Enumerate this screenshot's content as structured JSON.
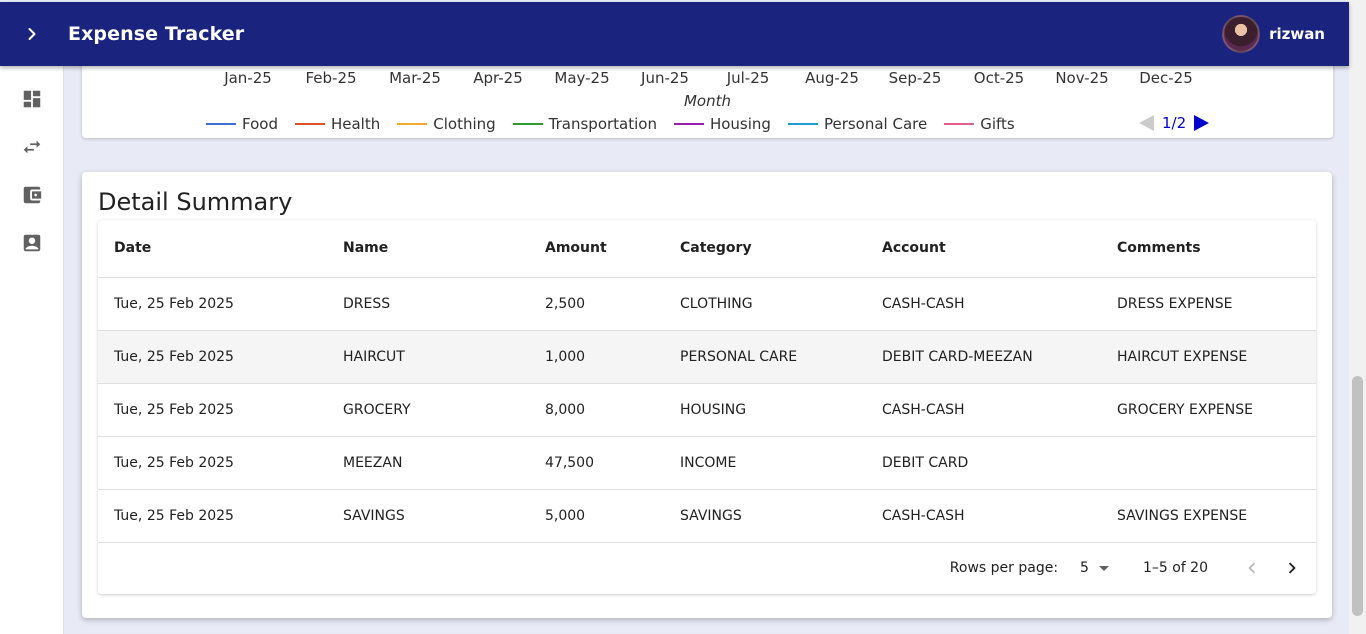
{
  "app": {
    "title": "Expense Tracker",
    "username": "rizwan"
  },
  "sidebar": {
    "items": [
      {
        "name": "dashboard",
        "icon": "dashboard-icon"
      },
      {
        "name": "transactions",
        "icon": "swap-horiz-icon"
      },
      {
        "name": "accounts",
        "icon": "wallet-icon"
      },
      {
        "name": "profile",
        "icon": "contact-icon"
      }
    ]
  },
  "chart": {
    "months": [
      "Jan-25",
      "Feb-25",
      "Mar-25",
      "Apr-25",
      "May-25",
      "Jun-25",
      "Jul-25",
      "Aug-25",
      "Sep-25",
      "Oct-25",
      "Nov-25",
      "Dec-25"
    ],
    "x_label": "Month",
    "legend": [
      {
        "label": "Food",
        "color": "#3b6fd4"
      },
      {
        "label": "Health",
        "color": "#e0502a"
      },
      {
        "label": "Clothing",
        "color": "#f0a830"
      },
      {
        "label": "Transportation",
        "color": "#2e9b2e"
      },
      {
        "label": "Housing",
        "color": "#9c1fb0"
      },
      {
        "label": "Personal Care",
        "color": "#1f9bd0"
      },
      {
        "label": "Gifts",
        "color": "#e0608a"
      }
    ],
    "legend_page": "1/2"
  },
  "summary": {
    "title": "Detail Summary",
    "columns": [
      "Date",
      "Name",
      "Amount",
      "Category",
      "Account",
      "Comments"
    ],
    "rows": [
      [
        "Tue, 25 Feb 2025",
        "DRESS",
        "2,500",
        "CLOTHING",
        "CASH-CASH",
        "DRESS EXPENSE"
      ],
      [
        "Tue, 25 Feb 2025",
        "HAIRCUT",
        "1,000",
        "PERSONAL CARE",
        "DEBIT CARD-MEEZAN",
        "HAIRCUT EXPENSE"
      ],
      [
        "Tue, 25 Feb 2025",
        "GROCERY",
        "8,000",
        "HOUSING",
        "CASH-CASH",
        "GROCERY EXPENSE"
      ],
      [
        "Tue, 25 Feb 2025",
        "MEEZAN",
        "47,500",
        "INCOME",
        "DEBIT CARD",
        ""
      ],
      [
        "Tue, 25 Feb 2025",
        "SAVINGS",
        "5,000",
        "SAVINGS",
        "CASH-CASH",
        "SAVINGS EXPENSE"
      ]
    ],
    "footer": {
      "rows_per_page_label": "Rows per page:",
      "rows_per_page": "5",
      "range": "1–5 of 20"
    }
  }
}
